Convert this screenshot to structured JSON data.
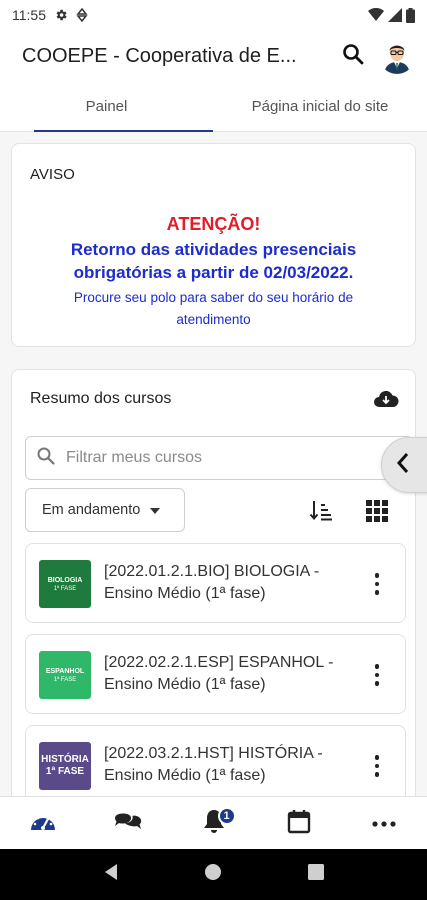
{
  "status_bar": {
    "time": "11:55"
  },
  "app_bar": {
    "title": "COOEPE - Cooperativa de E...",
    "search_icon": "search-icon",
    "avatar_icon": "user-avatar"
  },
  "tabs": [
    {
      "label": "Painel",
      "active": true
    },
    {
      "label": "Página inicial do site",
      "active": false
    }
  ],
  "notice": {
    "title": "AVISO",
    "attention": "ATENÇÃO!",
    "main_line1": "Retorno das atividades presenciais",
    "main_line2": "obrigatórias a partir de 02/03/2022.",
    "sub_line1": "Procure seu polo para saber do seu horário de",
    "sub_line2": "atendimento",
    "colors": {
      "attention": "#e11d2a",
      "main": "#1d2ccc"
    }
  },
  "courses": {
    "title": "Resumo dos cursos",
    "search_placeholder": "Filtrar meus cursos",
    "filter_value": "Em andamento",
    "items": [
      {
        "thumb_line1": "BIOLOGIA",
        "thumb_line2": "1ª FASE",
        "thumb_color": "#1f7a3d",
        "name": "[2022.01.2.1.BIO] BIOLOGIA - Ensino Médio (1ª fase)"
      },
      {
        "thumb_line1": "ESPANHOL",
        "thumb_line2": "1ª FASE",
        "thumb_color": "#2fb86a",
        "name": "[2022.02.2.1.ESP] ESPANHOL - Ensino Médio (1ª fase)"
      },
      {
        "thumb_line1": "HISTÓRIA",
        "thumb_line2": "1ª FASE",
        "thumb_color": "#5a4a8a",
        "name": "[2022.03.2.1.HST] HISTÓRIA - Ensino Médio (1ª fase)"
      }
    ]
  },
  "bottom_nav": {
    "items": [
      "dashboard-icon",
      "messages-icon",
      "notifications-icon",
      "calendar-icon",
      "more-icon"
    ],
    "notification_count": "1",
    "accent": "#1e3a8a"
  }
}
